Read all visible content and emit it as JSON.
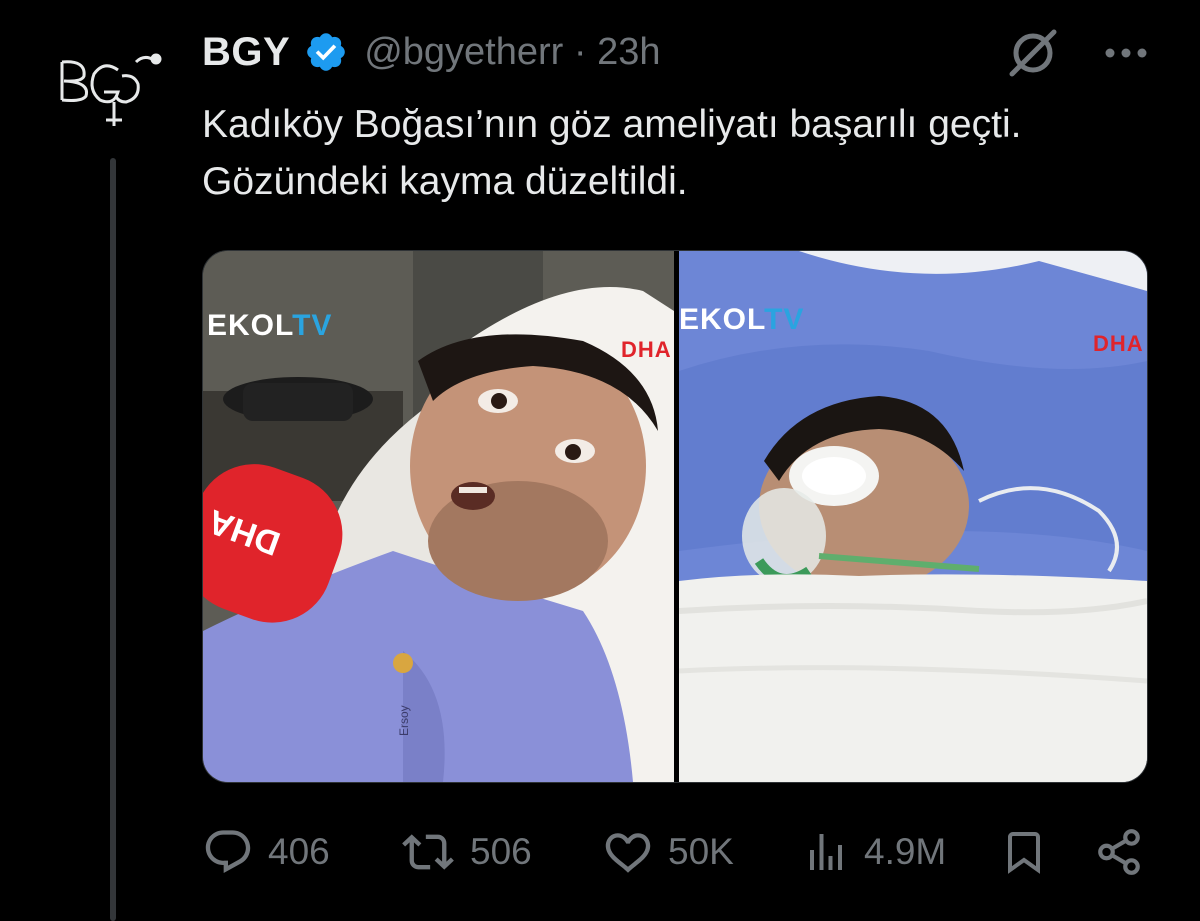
{
  "tweet": {
    "author": {
      "name": "BGY",
      "handle_time": "@bgyetherr · 23h",
      "avatar_text": "BGY"
    },
    "text": "Kadıköy Boğası’nın göz ameliyatı başarılı geçti. Gözündeki kayma düzeltildi.",
    "media": {
      "left": {
        "watermark_main": "EKOL",
        "watermark_tv": "TV",
        "mic_text": "DHA",
        "corner_text": "DHA",
        "badge_text": "Ersoy"
      },
      "right": {
        "watermark_main": "EKOL",
        "watermark_tv": "TV",
        "corner_text": "DHA"
      }
    },
    "actions": {
      "replies": "406",
      "reposts": "506",
      "likes": "50K",
      "views": "4.9M"
    }
  },
  "colors": {
    "background": "#000000",
    "text": "#e7e9ea",
    "muted": "#71767b",
    "verified": "#1d9bf0",
    "thread_line": "#333639"
  },
  "icons": [
    "grok-icon",
    "more-icon",
    "verified-icon",
    "reply-icon",
    "repost-icon",
    "like-icon",
    "views-icon",
    "bookmark-icon",
    "share-icon"
  ]
}
